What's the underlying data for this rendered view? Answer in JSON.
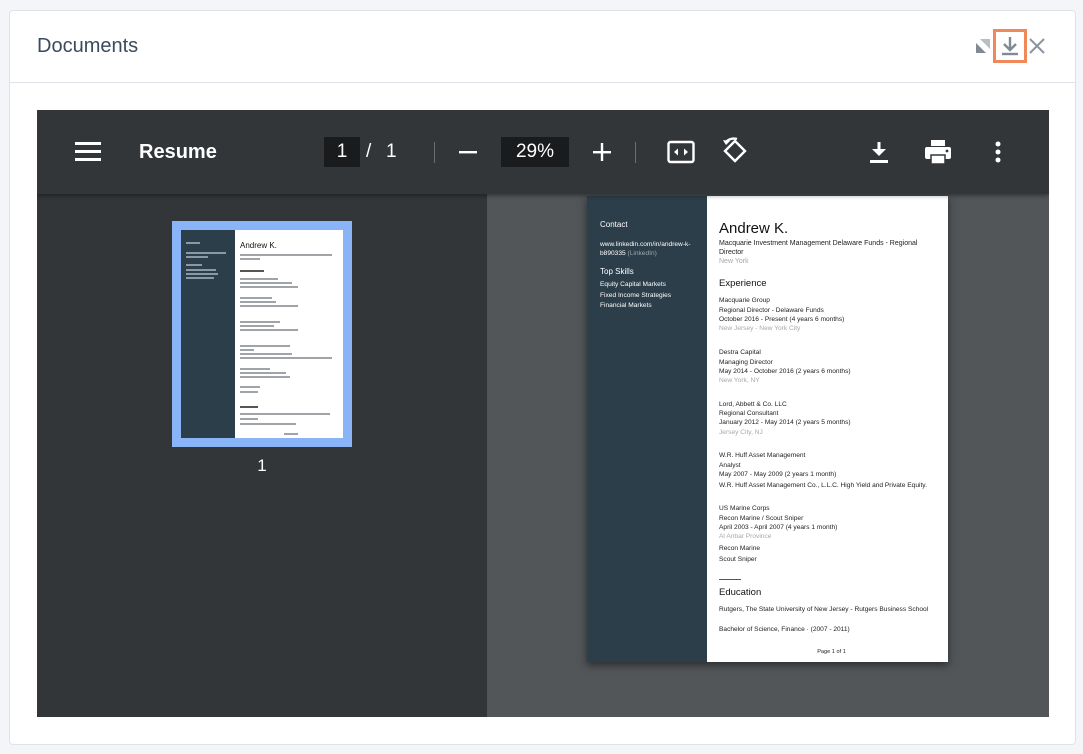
{
  "header": {
    "title": "Documents"
  },
  "toolbar": {
    "title": "Resume",
    "page_current": "1",
    "page_sep": "/",
    "page_total": "1",
    "zoom": "29%"
  },
  "thumbnail": {
    "page_number": "1"
  },
  "resume": {
    "contact_heading": "Contact",
    "linkedin": "www.linkedin.com/in/andrew-k-b890335",
    "linkedin_suffix": "(LinkedIn)",
    "skills_heading": "Top Skills",
    "skills": [
      "Equity Capital Markets",
      "Fixed Income Strategies",
      "Financial Markets"
    ],
    "name": "Andrew K.",
    "headline": "Macquarie Investment Management Delaware Funds - Regional Director",
    "location": "New York",
    "experience_heading": "Experience",
    "experience": [
      {
        "company": "Macquarie Group",
        "role": "Regional Director - Delaware Funds",
        "dates": "October 2016 - Present (4 years 6 months)",
        "location": "New Jersey - New York City"
      },
      {
        "company": "Destra Capital",
        "role": "Managing Director",
        "dates": "May 2014 - October 2016 (2 years 6 months)",
        "location": "New York, NY"
      },
      {
        "company": "Lord, Abbett & Co. LLC",
        "role": "Regional Consultant",
        "dates": "January 2012 - May 2014 (2 years 5 months)",
        "location": "Jersey City, NJ"
      },
      {
        "company": "W.R. Huff Asset Management",
        "role": "Analyst",
        "dates": "May 2007 - May 2009 (2 years 1 month)",
        "location": "W.R. Huff Asset Management Co., L.L.C. High Yield and Private Equity."
      },
      {
        "company": "US Marine Corps",
        "role": "Recon Marine / Scout Sniper",
        "dates": "April 2003 - April 2007 (4 years 1 month)",
        "location": "Al Anbar Province"
      }
    ],
    "extra_lines": [
      "Recon Marine",
      "Scout Sniper"
    ],
    "education_heading": "Education",
    "school": "Rutgers, The State University of New Jersey - Rutgers Business School",
    "degree": "Bachelor of Science, Finance · (2007 - 2011)",
    "footer": "Page 1 of 1"
  },
  "colors": {
    "accent_highlight": "#f0895a",
    "thumb_selected": "#8ab4f8",
    "toolbar_bg": "#323639"
  },
  "icons": [
    "expand-icon",
    "download-icon",
    "close-icon",
    "menu-icon",
    "zoom-out-icon",
    "zoom-in-icon",
    "fit-page-icon",
    "rotate-icon",
    "print-icon",
    "more-vertical-icon"
  ]
}
